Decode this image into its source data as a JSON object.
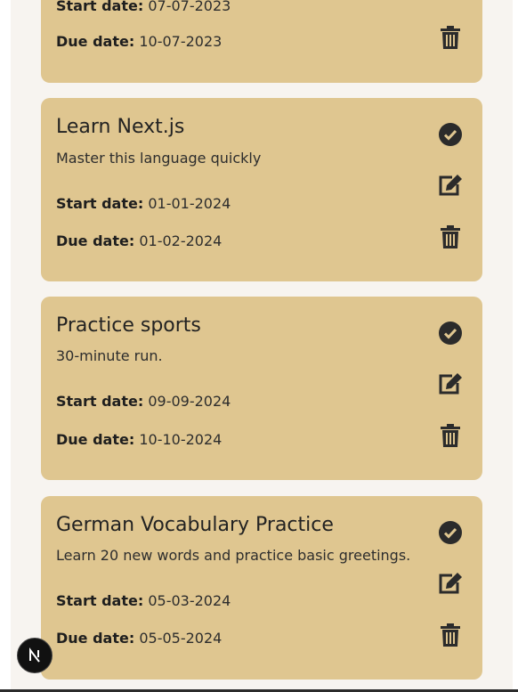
{
  "labels": {
    "start_date": "Start date:",
    "due_date": "Due date:"
  },
  "cards": [
    {
      "title": "",
      "description": "",
      "start_date": "07-07-2023",
      "due_date": "10-07-2023"
    },
    {
      "title": "Learn Next.js",
      "description": "Master this language quickly",
      "start_date": "01-01-2024",
      "due_date": "01-02-2024"
    },
    {
      "title": "Practice sports",
      "description": "30-minute run.",
      "start_date": "09-09-2024",
      "due_date": "10-10-2024"
    },
    {
      "title": "German Vocabulary Practice",
      "description": "Learn 20 new words and practice basic greetings.",
      "start_date": "05-03-2024",
      "due_date": "05-05-2024"
    }
  ],
  "icons": {
    "complete": "check-circle-icon",
    "edit": "edit-icon",
    "delete": "trash-icon",
    "dev_badge": "nextjs-logo-icon"
  },
  "colors": {
    "card_background": "#dfc690",
    "page_background": "#f7f4f0",
    "icon_color": "#2b2b2b"
  }
}
